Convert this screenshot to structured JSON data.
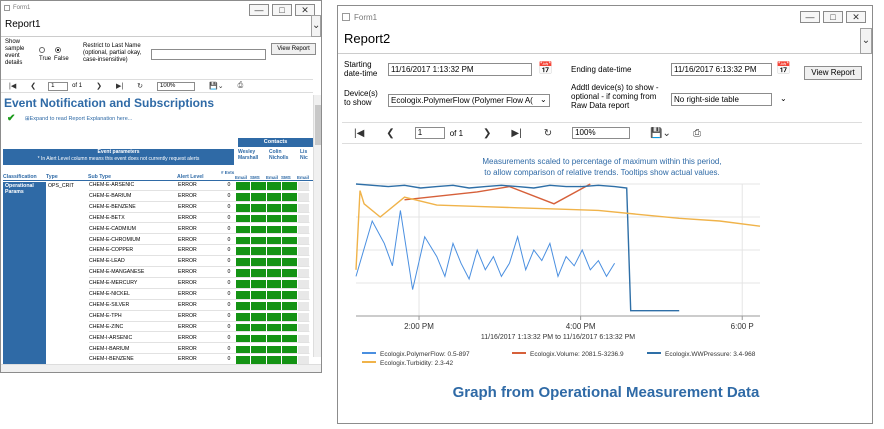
{
  "form1": {
    "window_title": "Form1",
    "report_tab": "Report1",
    "show_sample_label": "Show sample event details",
    "radio_true": "True",
    "radio_false": "False",
    "restrict_label": "Restrict to Last Name (optional, partial okay, case-insensitive)",
    "view_report": "View Report",
    "page_value": "1",
    "page_of": "of 1",
    "zoom": "100%",
    "report_title": "Event Notification and Subscriptions",
    "expand_text": "Expand to read Report Explanation here...",
    "contacts_header": "Contacts",
    "event_params_header": "Event parameters",
    "event_params_note": "* In Alert Level column means this event does not currently request alerts",
    "contacts": [
      "Wesley Marshall",
      "Colin Nicholls",
      "Lis Nic"
    ],
    "col_headers": {
      "classification": "Classification",
      "type": "Type",
      "subtype": "Sub Type",
      "alert": "Alert Level",
      "evts": "# Evts"
    },
    "sub_cols": [
      "Email",
      "SMS",
      "Email",
      "SMS",
      "Email"
    ],
    "classification_value": "Operational Params",
    "type_value": "OPS_CRIT",
    "rows": [
      {
        "sub": "CHEM-E-ARSENIC",
        "alert": "ERROR",
        "evts": "0"
      },
      {
        "sub": "CHEM-E-BARIUM",
        "alert": "ERROR",
        "evts": "0"
      },
      {
        "sub": "CHEM-E-BENZENE",
        "alert": "ERROR",
        "evts": "0"
      },
      {
        "sub": "CHEM-E-BETX",
        "alert": "ERROR",
        "evts": "0"
      },
      {
        "sub": "CHEM-E-CADMIUM",
        "alert": "ERROR",
        "evts": "0"
      },
      {
        "sub": "CHEM-E-CHROMIUM",
        "alert": "ERROR",
        "evts": "0"
      },
      {
        "sub": "CHEM-E-COPPER",
        "alert": "ERROR",
        "evts": "0"
      },
      {
        "sub": "CHEM-E-LEAD",
        "alert": "ERROR",
        "evts": "0"
      },
      {
        "sub": "CHEM-E-MANGANESE",
        "alert": "ERROR",
        "evts": "0"
      },
      {
        "sub": "CHEM-E-MERCURY",
        "alert": "ERROR",
        "evts": "0"
      },
      {
        "sub": "CHEM-E-NICKEL",
        "alert": "ERROR",
        "evts": "0"
      },
      {
        "sub": "CHEM-E-SILVER",
        "alert": "ERROR",
        "evts": "0"
      },
      {
        "sub": "CHEM-E-TPH",
        "alert": "ERROR",
        "evts": "0"
      },
      {
        "sub": "CHEM-E-ZINC",
        "alert": "ERROR",
        "evts": "0"
      },
      {
        "sub": "CHEM-I-ARSENIC",
        "alert": "ERROR",
        "evts": "0"
      },
      {
        "sub": "CHEM-I-BARIUM",
        "alert": "ERROR",
        "evts": "0"
      },
      {
        "sub": "CHEM-I-BENZENE",
        "alert": "ERROR",
        "evts": "0"
      }
    ]
  },
  "form2": {
    "window_title": "Form1",
    "report_tab": "Report2",
    "start_label": "Starting date-time",
    "start_value": "11/16/2017 1:13:32 PM",
    "end_label": "Ending date-time",
    "end_value": "11/16/2017 6:13:32 PM",
    "view_report": "View Report",
    "devices_label": "Device(s) to show",
    "devices_value": "Ecologix.PolymerFlow (Polymer Flow A(",
    "addtl_label": "Addtl device(s) to show - optional - if coming from Raw Data report",
    "addtl_value": "No right-side table",
    "page_value": "1",
    "page_of": "of 1",
    "zoom": "100%",
    "footer_title": "Graph from Operational Measurement Data"
  },
  "chart_data": {
    "type": "line",
    "title": "Measurements scaled to percentage of maximum within this period, to allow comparison of relative trends. Tooltips show actual values.",
    "title_lines": [
      "Measurements scaled to percentage of maximum within this period,",
      "to allow comparison of relative trends. Tooltips show actual values."
    ],
    "x_ticks": [
      "2:00 PM",
      "4:00 PM",
      "6:00 P"
    ],
    "x_range_label": "11/16/2017 1:13:32 PM to 11/16/2017 6:13:32 PM",
    "grid": true,
    "legend_position": "bottom",
    "colors": {
      "polymer": "#4a8fe0",
      "volume": "#d6603a",
      "pressure": "#2e6fa7",
      "turbidity": "#f0b34a"
    },
    "series": [
      {
        "name": "Ecologix.PolymerFlow: 0.5-897",
        "x": [
          0.0,
          0.2,
          0.35,
          0.45,
          0.55,
          0.7,
          0.85,
          1.0,
          1.1,
          1.2,
          1.3,
          1.4,
          1.5,
          1.6,
          1.7,
          1.8,
          1.9,
          2.0,
          2.1,
          2.2,
          2.3,
          2.4,
          2.5,
          2.6,
          2.7,
          2.8,
          2.9,
          3.0,
          3.1,
          3.2
        ],
        "y": [
          30,
          72,
          55,
          38,
          80,
          20,
          60,
          45,
          30,
          55,
          40,
          28,
          50,
          35,
          45,
          30,
          40,
          60,
          35,
          50,
          42,
          55,
          30,
          45,
          38,
          50,
          35,
          42,
          30,
          40
        ]
      },
      {
        "name": "Ecologix.Volume: 2081.5-3236.9",
        "x": [
          0.6,
          1.5,
          1.9,
          2.45,
          2.9
        ],
        "y": [
          88,
          94,
          98,
          85,
          100
        ]
      },
      {
        "name": "Ecologix.WWPressure: 3.4-968",
        "x": [
          0,
          0.2,
          0.4,
          0.6,
          0.8,
          1.0,
          1.2,
          1.4,
          1.6,
          1.8,
          2.0,
          2.2,
          2.4,
          2.6,
          2.8,
          3.0,
          3.2,
          3.35,
          3.4,
          3.6,
          4.0
        ],
        "y": [
          100,
          99,
          98,
          99,
          97,
          98,
          99,
          97,
          98,
          99,
          98,
          97,
          99,
          98,
          98,
          99,
          98,
          97,
          4,
          4,
          4
        ]
      },
      {
        "name": "Ecologix.Turbidity: 2.3-42",
        "x": [
          0,
          0.05,
          0.1,
          0.3,
          0.6,
          1.0,
          1.5,
          2.0,
          2.5,
          3.0,
          3.5,
          4.0,
          4.5,
          5.0
        ],
        "y": [
          35,
          95,
          85,
          75,
          90,
          84,
          83,
          82,
          81,
          80,
          77,
          74,
          72,
          68
        ]
      }
    ]
  }
}
